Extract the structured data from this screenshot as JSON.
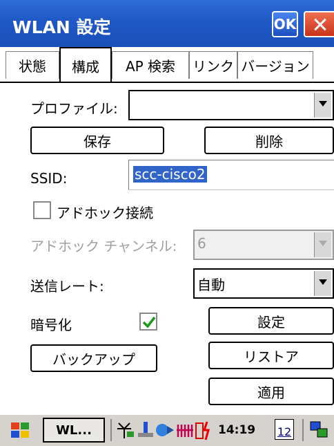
{
  "window": {
    "title": "WLAN 設定",
    "ok_label": "OK"
  },
  "tabs": [
    {
      "label": "状態"
    },
    {
      "label": "構成",
      "active": true
    },
    {
      "label": "AP 検索"
    },
    {
      "label": "リンク"
    },
    {
      "label": "バージョン"
    }
  ],
  "profile": {
    "label": "プロファイル:",
    "value": ""
  },
  "buttons": {
    "save": "保存",
    "delete": "削除",
    "settings": "設定",
    "backup": "バックアップ",
    "restore": "リストア",
    "apply": "適用"
  },
  "ssid": {
    "label": "SSID:",
    "value": "scc-cisco2"
  },
  "adhoc": {
    "label": "アドホック接続",
    "checked": false
  },
  "adhoc_channel": {
    "label": "アドホック チャンネル:",
    "value": "6",
    "enabled": false
  },
  "tx_rate": {
    "label": "送信レート:",
    "value": "自動"
  },
  "encryption": {
    "label": "暗号化",
    "checked": true
  },
  "taskbar": {
    "task_label": "WL...",
    "time": "14:19",
    "date_day": "12"
  },
  "colors": {
    "titlebar": "#1f58c5",
    "selection": "#3064c8",
    "check": "#1a9a1a"
  }
}
